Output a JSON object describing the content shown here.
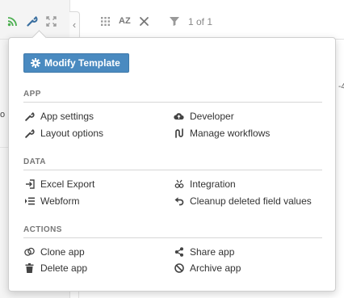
{
  "toolbar": {
    "icons": [
      "rss-feed-icon",
      "wrench-icon",
      "expand-icon",
      "collapse-left-icon",
      "grid-icon",
      "sort-az-icon",
      "tools-icon",
      "filter-icon"
    ],
    "sort_label": "AZ",
    "record_count": "1 of 1",
    "accent_green": "#4caf50"
  },
  "menu": {
    "modify_template": {
      "label": "Modify Template",
      "icon": "gear-icon",
      "color": "#4a8ac0"
    },
    "sections": {
      "app": {
        "title": "APP",
        "items": [
          {
            "label": "App settings",
            "icon": "wrench-icon"
          },
          {
            "label": "Developer",
            "icon": "cloud-upload-icon"
          },
          {
            "label": "Layout options",
            "icon": "wrench-icon"
          },
          {
            "label": "Manage workflows",
            "icon": "workflow-icon"
          }
        ]
      },
      "data": {
        "title": "DATA",
        "items": [
          {
            "label": "Excel Export",
            "icon": "export-icon"
          },
          {
            "label": "Integration",
            "icon": "integration-icon"
          },
          {
            "label": "Webform",
            "icon": "webform-icon"
          },
          {
            "label": "Cleanup deleted field values",
            "icon": "undo-icon"
          }
        ]
      },
      "actions": {
        "title": "ACTIONS",
        "items": [
          {
            "label": "Clone app",
            "icon": "clone-icon"
          },
          {
            "label": "Share app",
            "icon": "share-icon"
          },
          {
            "label": "Delete app",
            "icon": "trash-icon"
          },
          {
            "label": "Archive app",
            "icon": "archive-block-icon"
          }
        ]
      }
    }
  }
}
